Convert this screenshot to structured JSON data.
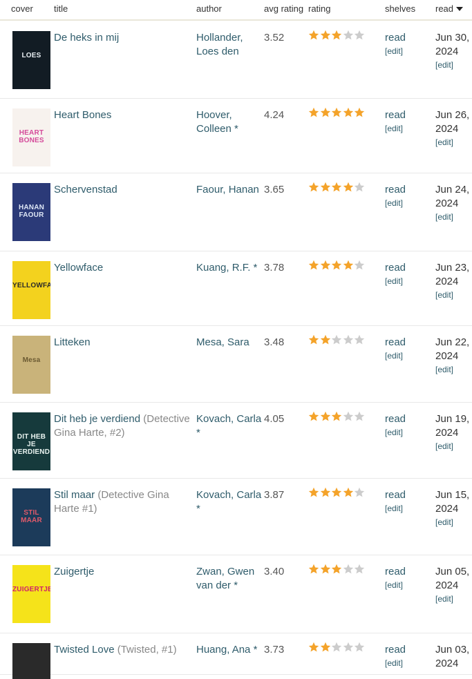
{
  "header": {
    "cover": "cover",
    "title": "title",
    "author": "author",
    "avg_rating": "avg rating",
    "rating": "rating",
    "shelves": "shelves",
    "read": "read"
  },
  "colors": {
    "link": "#2f5c6b",
    "star_on": "#f4a32a",
    "star_off": "#cccccc",
    "series": "#888888"
  },
  "books": [
    {
      "title": "De heks in mij",
      "series": "",
      "author": "Hollander, Loes den",
      "avg": "3.52",
      "rating": 3,
      "shelf": "read",
      "edit": "[edit]",
      "date_line1": "Jun 30,",
      "date_line2": "2024",
      "date_edit": "[edit]",
      "cover_text": "LOES",
      "cover_bg": "#121c24",
      "cover_fg": "#e8eef2"
    },
    {
      "title": "Heart Bones",
      "series": "",
      "author": "Hoover, Colleen *",
      "avg": "4.24",
      "rating": 5,
      "shelf": "read",
      "edit": "[edit]",
      "date_line1": "Jun 26,",
      "date_line2": "2024",
      "date_edit": "[edit]",
      "cover_text": "HEART BONES",
      "cover_bg": "#f7f2ee",
      "cover_fg": "#d44a9a"
    },
    {
      "title": "Schervenstad",
      "series": "",
      "author": "Faour, Hanan",
      "avg": "3.65",
      "rating": 4,
      "shelf": "read",
      "edit": "[edit]",
      "date_line1": "Jun 24,",
      "date_line2": "2024",
      "date_edit": "[edit]",
      "cover_text": "HANAN FAOUR",
      "cover_bg": "#2b3a78",
      "cover_fg": "#dde6f5"
    },
    {
      "title": "Yellowface",
      "series": "",
      "author": "Kuang, R.F. *",
      "avg": "3.78",
      "rating": 4,
      "shelf": "read",
      "edit": "[edit]",
      "date_line1": "Jun 23,",
      "date_line2": "2024",
      "date_edit": "[edit]",
      "cover_text": "YELLOWFACE",
      "cover_bg": "#f3d21e",
      "cover_fg": "#2a2a2a"
    },
    {
      "title": "Litteken",
      "series": "",
      "author": "Mesa, Sara",
      "avg": "3.48",
      "rating": 2,
      "shelf": "read",
      "edit": "[edit]",
      "date_line1": "Jun 22,",
      "date_line2": "2024",
      "date_edit": "[edit]",
      "cover_text": "Mesa",
      "cover_bg": "#c9b37a",
      "cover_fg": "#6b5a32"
    },
    {
      "title": "Dit heb je verdiend",
      "series": "(Detective Gina Harte, #2)",
      "author": "Kovach, Carla *",
      "avg": "4.05",
      "rating": 3,
      "shelf": "read",
      "edit": "[edit]",
      "date_line1": "Jun 19,",
      "date_line2": "2024",
      "date_edit": "[edit]",
      "cover_text": "DIT HEB JE VERDIEND",
      "cover_bg": "#163a3c",
      "cover_fg": "#e9f3f0"
    },
    {
      "title": "Stil maar",
      "series": "(Detective Gina Harte #1)",
      "author": "Kovach, Carla *",
      "avg": "3.87",
      "rating": 4,
      "shelf": "read",
      "edit": "[edit]",
      "date_line1": "Jun 15,",
      "date_line2": "2024",
      "date_edit": "[edit]",
      "cover_text": "STIL MAAR",
      "cover_bg": "#1c3b5a",
      "cover_fg": "#e05a6a"
    },
    {
      "title": "Zuigertje",
      "series": "",
      "author": "Zwan, Gwen van der *",
      "avg": "3.40",
      "rating": 3,
      "shelf": "read",
      "edit": "[edit]",
      "date_line1": "Jun 05,",
      "date_line2": "2024",
      "date_edit": "[edit]",
      "cover_text": "ZUIGERTJE",
      "cover_bg": "#f5e31a",
      "cover_fg": "#d0216a"
    },
    {
      "title": "Twisted Love",
      "series": "(Twisted, #1)",
      "author": "Huang, Ana *",
      "avg": "3.73",
      "rating": 2,
      "shelf": "read",
      "edit": "[edit]",
      "date_line1": "Jun 03,",
      "date_line2": "2024",
      "date_edit": "",
      "cover_text": "",
      "cover_bg": "#2a2a2a",
      "cover_fg": "#dddddd"
    }
  ]
}
